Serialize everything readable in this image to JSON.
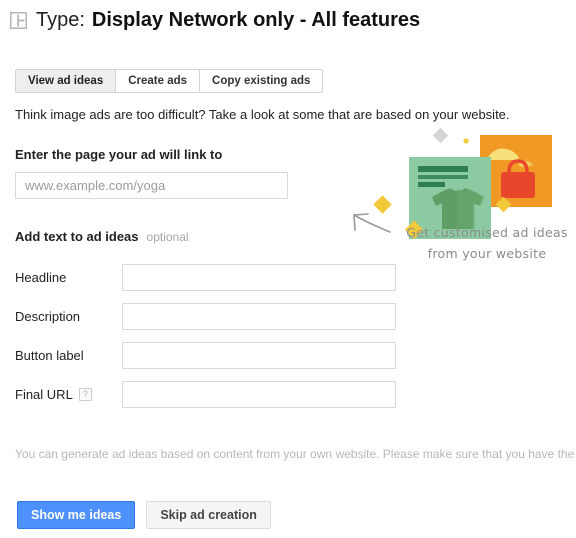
{
  "header": {
    "icon": "layout-grid-icon",
    "label": "Type:",
    "value": "Display Network only - All features"
  },
  "tabs": [
    {
      "label": "View ad ideas",
      "selected": true
    },
    {
      "label": "Create ads",
      "selected": false
    },
    {
      "label": "Copy existing ads",
      "selected": false
    }
  ],
  "intro": "Think image ads are too difficult? Take a look at some that are based on your website.",
  "url_section": {
    "label": "Enter the page your ad will link to",
    "value": "",
    "placeholder": "www.example.com/yoga"
  },
  "add_text_section": {
    "title": "Add text to ad ideas",
    "optional": "optional",
    "fields": [
      {
        "label": "Headline",
        "value": "",
        "placeholder": "",
        "help": false
      },
      {
        "label": "Description",
        "value": "",
        "placeholder": "",
        "help": false
      },
      {
        "label": "Button label",
        "value": "",
        "placeholder": "",
        "help": false
      },
      {
        "label": "Final URL",
        "value": "",
        "placeholder": "",
        "help": true,
        "help_glyph": "?"
      }
    ]
  },
  "illustration": {
    "note_line1": "Get customised ad ideas",
    "note_line2": "from your website",
    "arrow": "curved-arrow-left-icon",
    "cards": [
      {
        "name": "orange-product-card",
        "color": "#f09a25"
      },
      {
        "name": "green-product-card",
        "color": "#8ccaa3"
      }
    ],
    "colors": {
      "orange_card": "#f09a25",
      "green_card": "#8ccaa3",
      "cap_yellow": "#f7df7a",
      "bag_red": "#e8472b",
      "shirt_green": "#5f9e64",
      "bar_green": "#2f7d53",
      "diamond_yellow": "#f2c938",
      "diamond_grey": "#d6d6d6",
      "dot_yellow": "#f2c938"
    }
  },
  "disclaimer": "You can generate ad ideas based on content from your own website. Please make sure that you have the legal right",
  "footer": {
    "primary_label": "Show me ideas",
    "secondary_label": "Skip ad creation",
    "primary_color": "#4d90fe"
  }
}
